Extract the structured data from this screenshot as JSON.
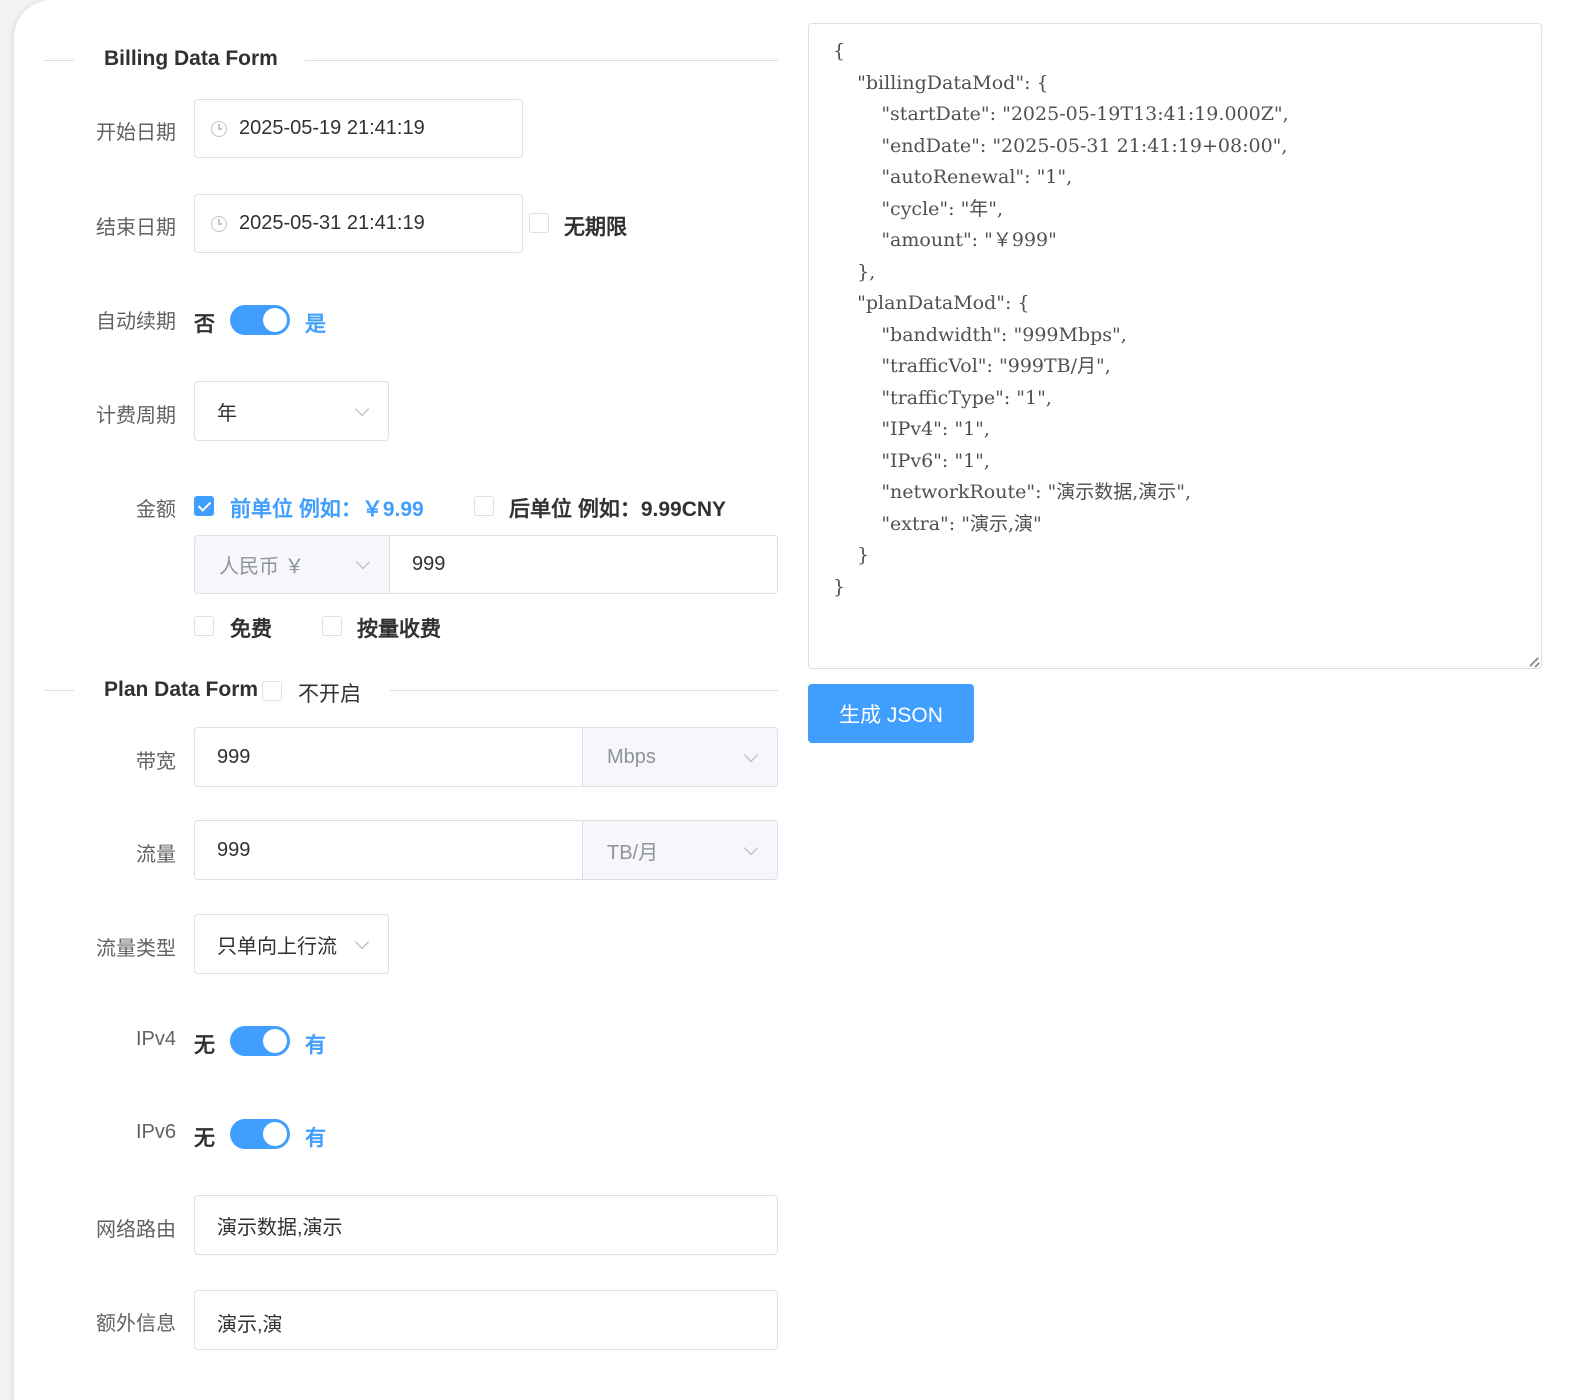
{
  "billing_section": {
    "title": "Billing Data Form"
  },
  "start_date": {
    "label": "开始日期",
    "value": "2025-05-19 21:41:19"
  },
  "end_date": {
    "label": "结束日期",
    "value": "2025-05-31 21:41:19",
    "unlimited_label": "无期限",
    "unlimited_checked": false
  },
  "auto_renewal": {
    "label": "自动续期",
    "off_text": "否",
    "on_text": "是",
    "on": true
  },
  "cycle": {
    "label": "计费周期",
    "value": "年"
  },
  "amount": {
    "label": "金额",
    "prefix_unit_label": "前单位 例如：￥9.99",
    "prefix_unit_checked": true,
    "suffix_unit_label": "后单位 例如：9.99CNY",
    "suffix_unit_checked": false,
    "currency": "人民币 ￥",
    "value": "999",
    "free_label": "免费",
    "free_checked": false,
    "metered_label": "按量收费",
    "metered_checked": false
  },
  "plan_section": {
    "title": "Plan Data Form",
    "disable_label": "不开启",
    "disable_checked": false
  },
  "bandwidth": {
    "label": "带宽",
    "value": "999",
    "unit": "Mbps"
  },
  "traffic": {
    "label": "流量",
    "value": "999",
    "unit": "TB/月"
  },
  "traffic_type": {
    "label": "流量类型",
    "value": "只单向上行流"
  },
  "ipv4": {
    "label": "IPv4",
    "off_text": "无",
    "on_text": "有",
    "on": true
  },
  "ipv6": {
    "label": "IPv6",
    "off_text": "无",
    "on_text": "有",
    "on": true
  },
  "network_route": {
    "label": "网络路由",
    "value": "演示数据,演示"
  },
  "extra": {
    "label": "额外信息",
    "value": "演示,演"
  },
  "json_output": "{\n    \"billingDataMod\": {\n        \"startDate\": \"2025-05-19T13:41:19.000Z\",\n        \"endDate\": \"2025-05-31 21:41:19+08:00\",\n        \"autoRenewal\": \"1\",\n        \"cycle\": \"年\",\n        \"amount\": \"￥999\"\n    },\n    \"planDataMod\": {\n        \"bandwidth\": \"999Mbps\",\n        \"trafficVol\": \"999TB/月\",\n        \"trafficType\": \"1\",\n        \"IPv4\": \"1\",\n        \"IPv6\": \"1\",\n        \"networkRoute\": \"演示数据,演示\",\n        \"extra\": \"演示,演\"\n    }\n}",
  "generate_button": "生成 JSON",
  "colors": {
    "primary": "#409eff",
    "border": "#dcdfe6",
    "text": "#303133",
    "label": "#606266"
  }
}
